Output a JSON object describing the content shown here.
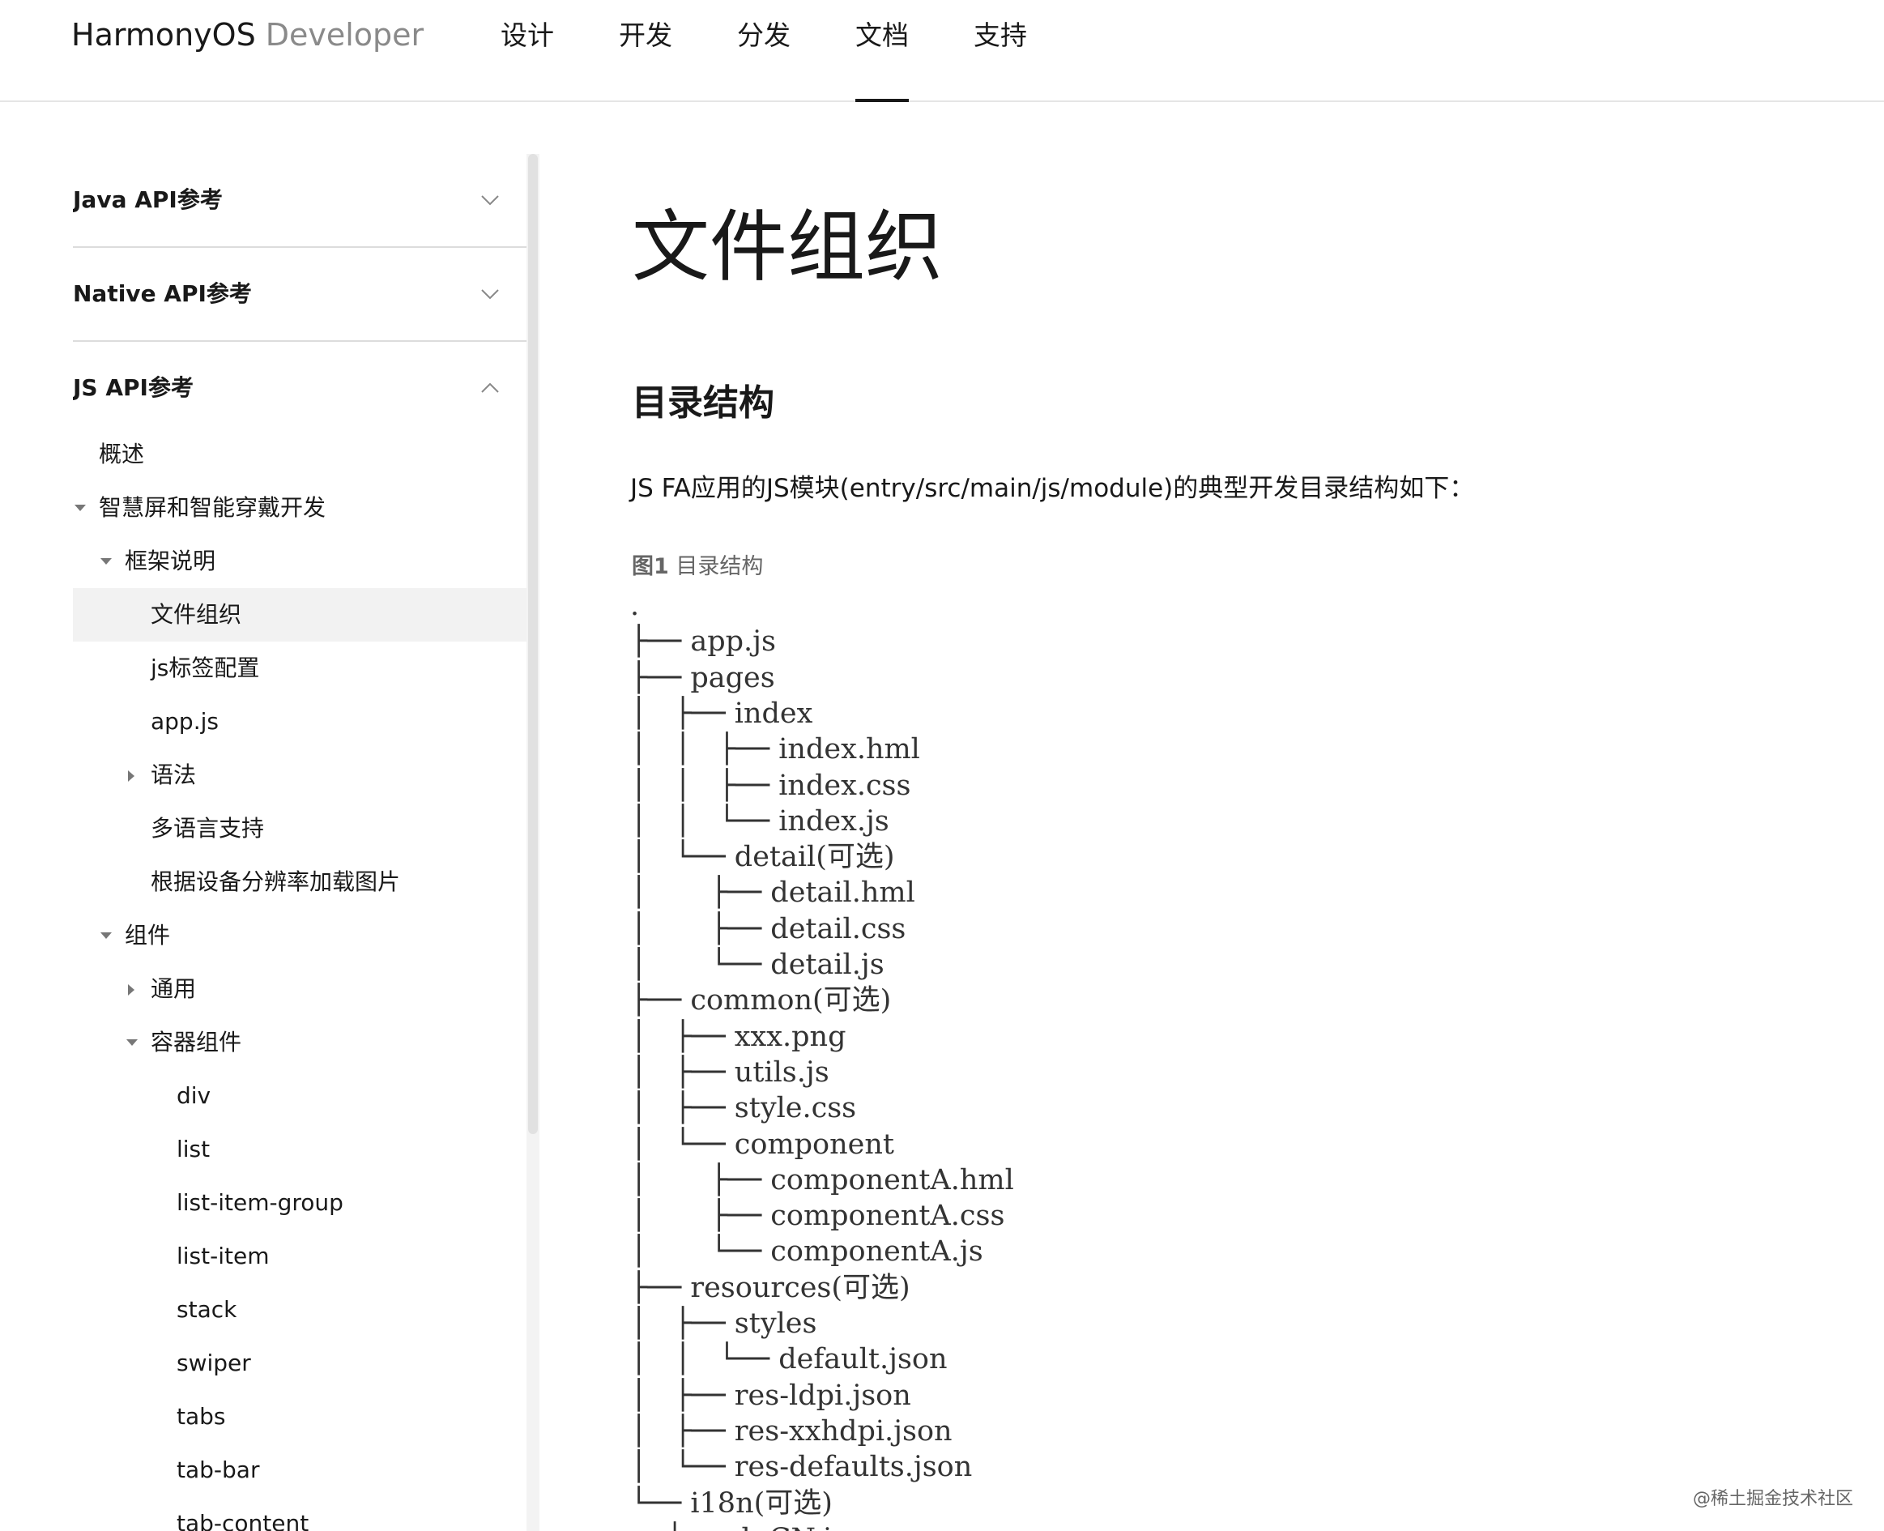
{
  "header": {
    "brand_main": "HarmonyOS",
    "brand_sub": "Developer",
    "nav": [
      "设计",
      "开发",
      "分发",
      "文档",
      "支持"
    ],
    "active_nav": "文档"
  },
  "sidebar": {
    "sections": [
      {
        "label": "Java API参考",
        "state": "collapsed"
      },
      {
        "label": "Native API参考",
        "state": "collapsed"
      },
      {
        "label": "JS API参考",
        "state": "expanded"
      }
    ],
    "tree": [
      {
        "label": "概述",
        "level": 1,
        "toggle": "none"
      },
      {
        "label": "智慧屏和智能穿戴开发",
        "level": 1,
        "toggle": "expanded"
      },
      {
        "label": "框架说明",
        "level": 2,
        "toggle": "expanded"
      },
      {
        "label": "文件组织",
        "level": 3,
        "toggle": "none",
        "selected": true
      },
      {
        "label": "js标签配置",
        "level": 3,
        "toggle": "none"
      },
      {
        "label": "app.js",
        "level": 3,
        "toggle": "none"
      },
      {
        "label": "语法",
        "level": 3,
        "toggle": "collapsed"
      },
      {
        "label": "多语言支持",
        "level": 3,
        "toggle": "none"
      },
      {
        "label": "根据设备分辨率加载图片",
        "level": 3,
        "toggle": "none"
      },
      {
        "label": "组件",
        "level": 2,
        "toggle": "expanded"
      },
      {
        "label": "通用",
        "level": 3,
        "toggle": "collapsed"
      },
      {
        "label": "容器组件",
        "level": 3,
        "toggle": "expanded"
      },
      {
        "label": "div",
        "level": 4,
        "toggle": "none"
      },
      {
        "label": "list",
        "level": 4,
        "toggle": "none"
      },
      {
        "label": "list-item-group",
        "level": 4,
        "toggle": "none"
      },
      {
        "label": "list-item",
        "level": 4,
        "toggle": "none"
      },
      {
        "label": "stack",
        "level": 4,
        "toggle": "none"
      },
      {
        "label": "swiper",
        "level": 4,
        "toggle": "none"
      },
      {
        "label": "tabs",
        "level": 4,
        "toggle": "none"
      },
      {
        "label": "tab-bar",
        "level": 4,
        "toggle": "none"
      },
      {
        "label": "tab-content",
        "level": 4,
        "toggle": "none"
      }
    ]
  },
  "content": {
    "title": "文件组织",
    "section_heading": "目录结构",
    "intro": "JS FA应用的JS模块(entry/src/main/js/module)的典型开发目录结构如下：",
    "figure_label": "图1",
    "figure_title": "目录结构",
    "tree_lines": [
      ".",
      "├── app.js",
      "├── pages",
      "│   ├── index",
      "│   │   ├── index.hml",
      "│   │   ├── index.css",
      "│   │   └── index.js",
      "│   └── detail(可选)",
      "│       ├── detail.hml",
      "│       ├── detail.css",
      "│       └── detail.js",
      "├── common(可选)",
      "│   ├── xxx.png",
      "│   ├── utils.js",
      "│   ├── style.css",
      "│   └── component",
      "│       ├── componentA.hml",
      "│       ├── componentA.css",
      "│       └── componentA.js",
      "├── resources(可选)",
      "│   ├── styles",
      "│   │   └── default.json",
      "│   ├── res-ldpi.json",
      "│   ├── res-xxhdpi.json",
      "│   └── res-defaults.json",
      "└── i18n(可选)",
      "    ├── zh-CN.json"
    ]
  },
  "watermark": "@稀土掘金技术社区",
  "colors": {
    "text": "#191919",
    "muted": "#8a8a8a",
    "selected_bg": "#f2f2f2",
    "divider": "#dcdcdc"
  }
}
